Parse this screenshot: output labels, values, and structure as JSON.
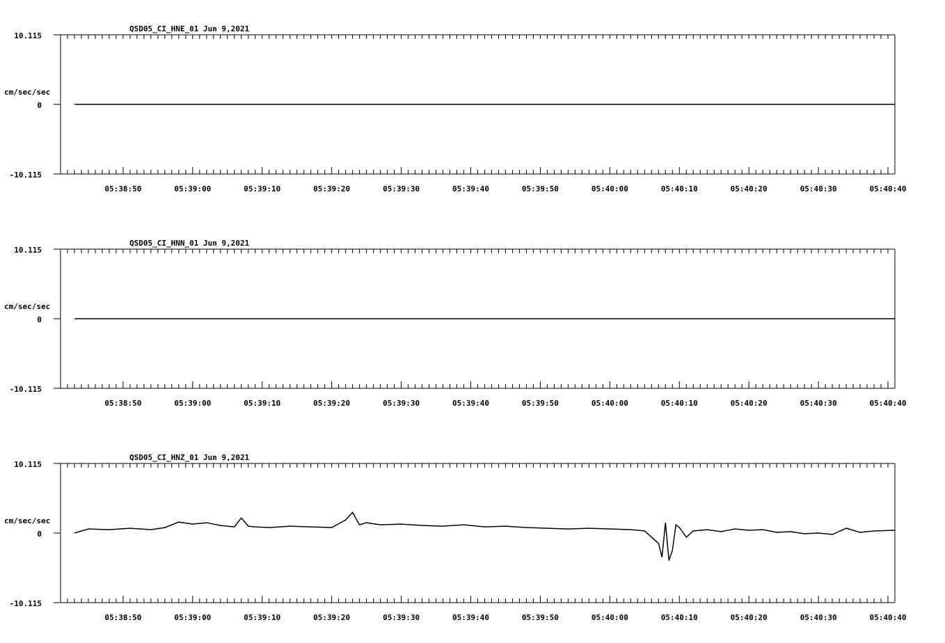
{
  "chart_data": [
    {
      "type": "line",
      "title": "QSD05_CI_HNE_01  Jun 9,2021",
      "ylabel": "cm/sec/sec",
      "ylim": [
        -10.115,
        10.115
      ],
      "ytick_labels": [
        "10.115",
        "0",
        "-10.115"
      ],
      "xlim_seconds": [
        "05:38:41",
        "05:40:41"
      ],
      "xtick_labels": [
        "05:38:50",
        "05:39:00",
        "05:39:10",
        "05:39:20",
        "05:39:30",
        "05:39:40",
        "05:39:50",
        "05:40:00",
        "05:40:10",
        "05:40:20",
        "05:40:30",
        "05:40:40"
      ],
      "series": [
        {
          "x": [
            "05:38:43",
            "05:40:41"
          ],
          "y": [
            0,
            0
          ]
        }
      ]
    },
    {
      "type": "line",
      "title": "QSD05_CI_HNN_01  Jun 9,2021",
      "ylabel": "cm/sec/sec",
      "ylim": [
        -10.115,
        10.115
      ],
      "ytick_labels": [
        "10.115",
        "0",
        "-10.115"
      ],
      "xtick_labels": [
        "05:38:50",
        "05:39:00",
        "05:39:10",
        "05:39:20",
        "05:39:30",
        "05:39:40",
        "05:39:50",
        "05:40:00",
        "05:40:10",
        "05:40:20",
        "05:40:30",
        "05:40:40"
      ],
      "series": [
        {
          "x": [
            "05:38:43",
            "05:40:41"
          ],
          "y": [
            0,
            0
          ]
        }
      ]
    },
    {
      "type": "line",
      "title": "QSD05_CI_HNZ_01  Jun 9,2021",
      "ylabel": "cm/sec/sec",
      "ylim": [
        -10.115,
        10.115
      ],
      "ytick_labels": [
        "10.115",
        "0",
        "-10.115"
      ],
      "xtick_labels": [
        "05:38:50",
        "05:39:00",
        "05:39:10",
        "05:39:20",
        "05:39:30",
        "05:39:40",
        "05:39:50",
        "05:40:00",
        "05:40:10",
        "05:40:20",
        "05:40:30",
        "05:40:40"
      ],
      "series": [
        {
          "x": [
            "05:38:43",
            "05:38:45",
            "05:38:48",
            "05:38:51",
            "05:38:54",
            "05:38:56",
            "05:38:58",
            "05:39:00",
            "05:39:02",
            "05:39:04",
            "05:39:06",
            "05:39:07",
            "05:39:08",
            "05:39:09",
            "05:39:11",
            "05:39:14",
            "05:39:17",
            "05:39:20",
            "05:39:22",
            "05:39:23",
            "05:39:24",
            "05:39:25",
            "05:39:27",
            "05:39:30",
            "05:39:33",
            "05:39:36",
            "05:39:39",
            "05:39:42",
            "05:39:45",
            "05:39:48",
            "05:39:51",
            "05:39:54",
            "05:39:57",
            "05:40:00",
            "05:40:03",
            "05:40:05",
            "05:40:07",
            "05:40:07.5",
            "05:40:08",
            "05:40:08.5",
            "05:40:09",
            "05:40:09.5",
            "05:40:10",
            "05:40:11",
            "05:40:12",
            "05:40:14",
            "05:40:16",
            "05:40:18",
            "05:40:20",
            "05:40:22",
            "05:40:24",
            "05:40:26",
            "05:40:28",
            "05:40:30",
            "05:40:32",
            "05:40:34",
            "05:40:36",
            "05:40:38",
            "05:40:41"
          ],
          "y": [
            0,
            0.6,
            0.5,
            0.7,
            0.5,
            0.8,
            1.6,
            1.3,
            1.5,
            1.1,
            0.9,
            2.2,
            1.0,
            0.9,
            0.8,
            1.0,
            0.9,
            0.8,
            1.9,
            3.0,
            1.2,
            1.5,
            1.2,
            1.3,
            1.1,
            1.0,
            1.2,
            0.9,
            1.0,
            0.8,
            0.7,
            0.6,
            0.7,
            0.6,
            0.5,
            0.3,
            -1.5,
            -3.5,
            1.5,
            -4.0,
            -2.5,
            1.2,
            0.8,
            -0.6,
            0.3,
            0.5,
            0.2,
            0.6,
            0.4,
            0.5,
            0.1,
            0.2,
            -0.1,
            0.0,
            -0.2,
            0.7,
            0.1,
            0.3,
            0.4
          ]
        }
      ]
    }
  ]
}
